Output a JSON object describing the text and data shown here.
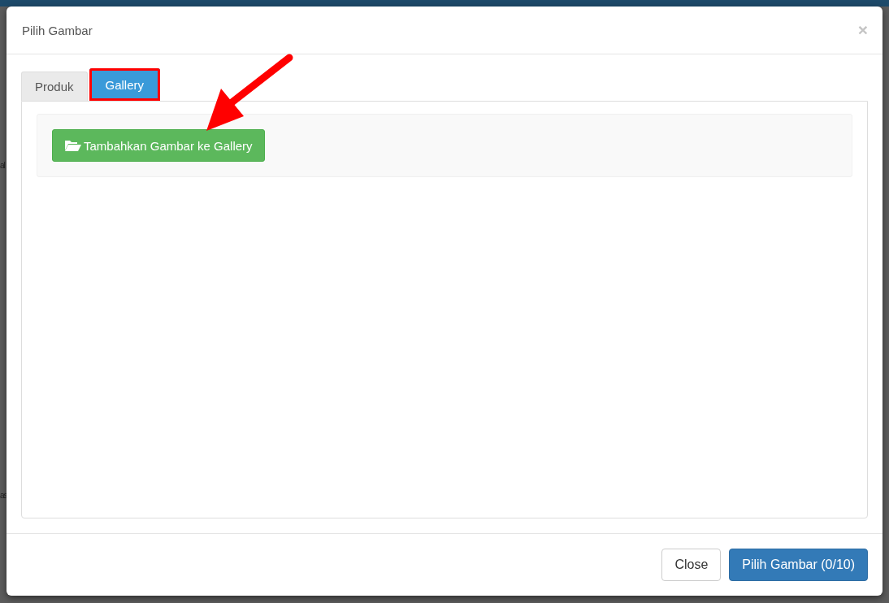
{
  "backdrop": {
    "fragments": [
      "al",
      "as"
    ]
  },
  "dialog": {
    "title": "Pilih Gambar",
    "close_symbol": "×"
  },
  "tabs": [
    {
      "label": "Produk",
      "selected": false,
      "highlighted": false
    },
    {
      "label": "Gallery",
      "selected": true,
      "highlighted": true
    }
  ],
  "panel": {
    "add_button": {
      "label": "Tambahkan Gambar ke Gallery"
    },
    "annotation": {
      "kind": "arrow"
    }
  },
  "footer": {
    "buttons": [
      {
        "label": "Close",
        "kind": "default"
      },
      {
        "label": "Pilih Gambar (0/10)",
        "kind": "primary"
      }
    ]
  }
}
